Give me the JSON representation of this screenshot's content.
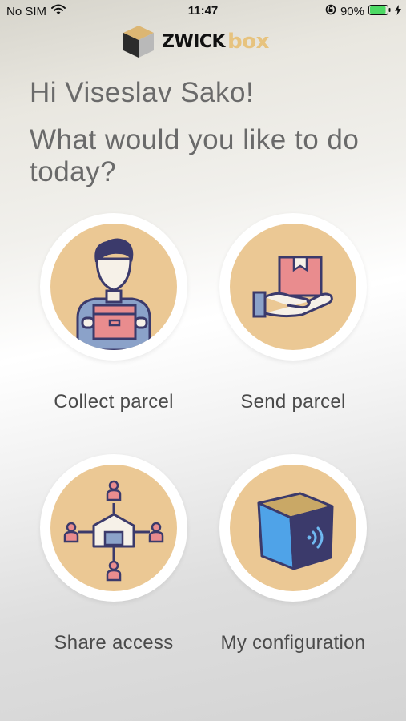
{
  "status_bar": {
    "carrier": "No SIM",
    "time": "11:47",
    "battery": "90%"
  },
  "header": {
    "logo_word1": "ZWICK",
    "logo_word2": "box"
  },
  "greeting": "Hi Viseslav Sako!",
  "prompt": "What would you like to do today?",
  "actions": [
    {
      "label": "Collect parcel",
      "icon": "person-holding-box-icon"
    },
    {
      "label": "Send parcel",
      "icon": "hand-with-box-icon"
    },
    {
      "label": "Share access",
      "icon": "network-share-icon"
    },
    {
      "label": "My configuration",
      "icon": "smart-box-icon"
    }
  ],
  "colors": {
    "accent": "#ebc894",
    "text": "#6a6a6a",
    "battery": "#4cd964"
  }
}
